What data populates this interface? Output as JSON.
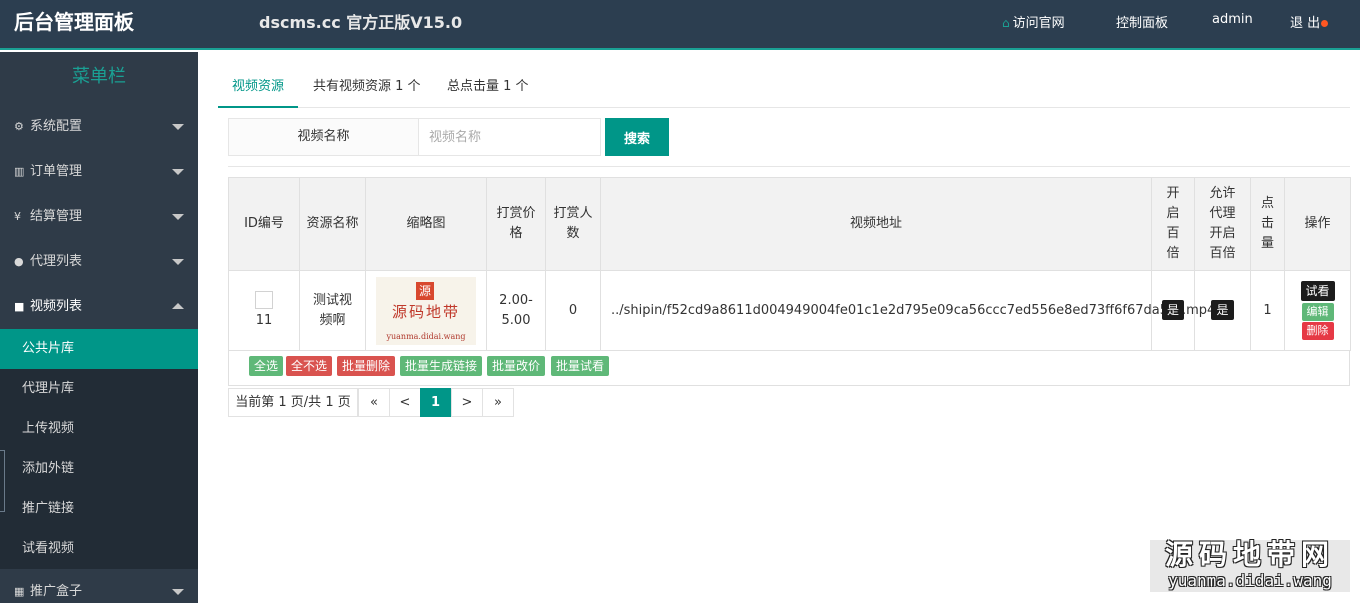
{
  "header": {
    "brand": "后台管理面板",
    "version": "dscms.cc 官方正版V15.0",
    "nav": {
      "visit_site": "访问官网",
      "dashboard": "控制面板",
      "user": "admin",
      "logout": "退 出"
    }
  },
  "sidebar": {
    "title": "菜单栏",
    "groups": [
      {
        "icon": "gear-icon",
        "label": "系统配置"
      },
      {
        "icon": "bar-chart-icon",
        "label": "订单管理"
      },
      {
        "icon": "yen-icon",
        "label": "结算管理"
      },
      {
        "icon": "user-icon",
        "label": "代理列表"
      },
      {
        "icon": "video-camera-icon",
        "label": "视频列表"
      },
      {
        "icon": "table-icon",
        "label": "推广盒子"
      }
    ],
    "video_submenu": [
      "公共片库",
      "代理片库",
      "上传视频",
      "添加外链",
      "推广链接",
      "试看视频"
    ]
  },
  "tabs": {
    "active": "视频资源",
    "count_text": "共有视频资源 1 个",
    "clicks_text": "总点击量 1 个"
  },
  "search": {
    "label": "视频名称",
    "placeholder": "视频名称",
    "button": "搜索"
  },
  "table": {
    "headers": [
      "ID编号",
      "资源名称",
      "缩略图",
      "打赏价格",
      "打赏人数",
      "视频地址",
      "开启百倍",
      "允许代理开启百倍",
      "点击量",
      "操作"
    ],
    "rows": [
      {
        "id": "11",
        "name": "测试视频啊",
        "thumb_seal": "源",
        "thumb_text": "源码地带",
        "thumb_url": "yuanma.didai.wang",
        "price": "2.00-5.00",
        "donors": "0",
        "path": "../shipin/f52cd9a8611d004949004fe01c1e2d795e09ca56ccc7ed556e8ed73ff6f67da5cs.mp4",
        "hundredfold": "是",
        "agent_hundredfold": "是",
        "clicks": "1",
        "ops": {
          "watch": "试看",
          "edit": "编辑",
          "delete": "删除"
        }
      }
    ]
  },
  "batch": {
    "select_all": "全选",
    "select_none": "全不选",
    "batch_delete": "批量删除",
    "batch_links": "批量生成链接",
    "batch_price": "批量改价",
    "batch_preview": "批量试看"
  },
  "pager": {
    "info": "当前第 1 页/共 1 页",
    "first": "«",
    "prev": "<",
    "current": "1",
    "next": ">",
    "last": "»"
  },
  "watermark": {
    "big": "源码地带网",
    "small": "yuanma.didai.wang"
  },
  "colors": {
    "header_bg": "#2c3e50",
    "sidebar_bg": "#2f3b48",
    "accent": "#009688",
    "green": "#5fb878",
    "red": "#e63945"
  }
}
